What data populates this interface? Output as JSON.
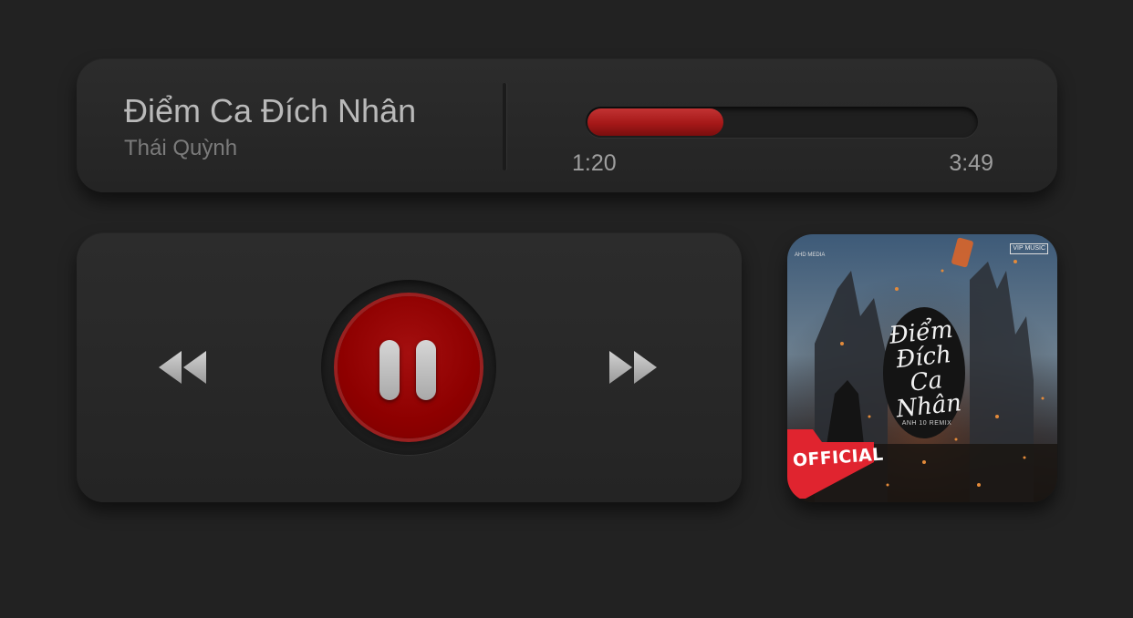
{
  "song": {
    "title": "Điểm Ca Đích Nhân",
    "artist": "Thái Quỳnh"
  },
  "progress": {
    "elapsed": "1:20",
    "total": "3:49",
    "fraction": 0.35,
    "fill_color": "#a51818"
  },
  "controls": {
    "previous_icon": "rewind-icon",
    "pause_icon": "pause-icon",
    "next_icon": "fast-forward-icon",
    "accent_color": "#8e0000"
  },
  "album_art": {
    "title_art": "Điểm Đích Ca Nhân",
    "credit": "ANH 10 REMIX",
    "badge": "OFFICIAL",
    "logo_left": "AHD MEDIA",
    "logo_right": "VIP MUSIC"
  }
}
